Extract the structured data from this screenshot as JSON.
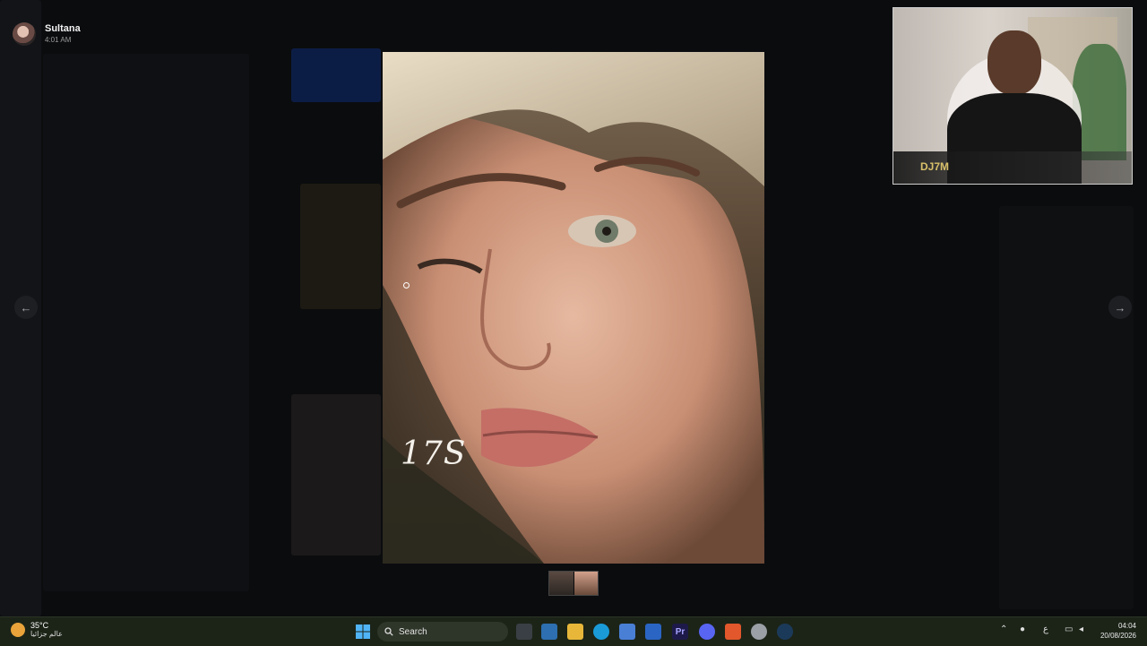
{
  "viewer": {
    "uploader_name": "Sultana",
    "upload_time": "4:01 AM",
    "image_caption": "17S",
    "prev_glyph": "←",
    "next_glyph": "→"
  },
  "webcam": {
    "logo_text": "DJ7M"
  },
  "taskbar": {
    "weather_temp": "35°C",
    "weather_desc": "عالم جزائيا",
    "search_label": "Search",
    "lang": "ع",
    "time": "04:04",
    "date": "20/08/2026"
  },
  "icons": {
    "start": "windows-start-icon",
    "search": "search-icon",
    "apps": [
      "task-view-icon",
      "widgets-icon",
      "file-explorer-icon",
      "edge-icon",
      "store-icon",
      "mail-icon",
      "premiere-icon",
      "discord-icon",
      "brave-icon",
      "chrome-icon",
      "steam-icon"
    ]
  }
}
